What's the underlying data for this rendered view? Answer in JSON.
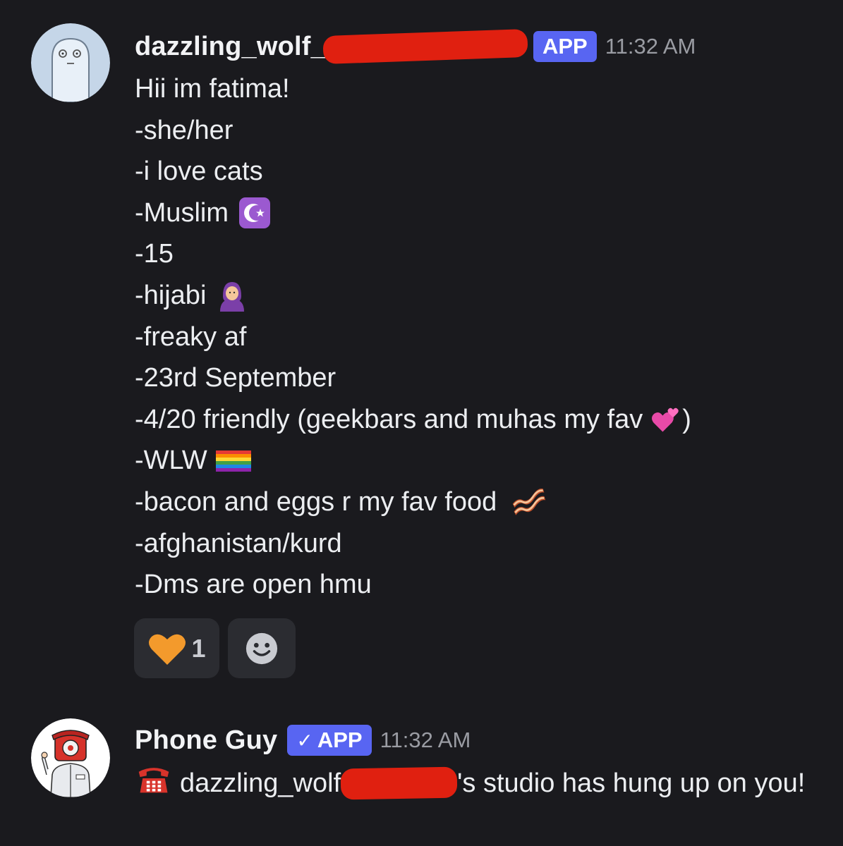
{
  "messages": [
    {
      "username": "dazzling_wolf_",
      "badge": "APP",
      "timestamp": "11:32 AM",
      "lines": [
        "Hii im fatima!",
        "-she/her",
        "-i love cats",
        "-Muslim",
        "-15",
        "-hijabi",
        "-freaky af",
        "-23rd September",
        "-4/20 friendly (geekbars and muhas my fav",
        "-WLW",
        "-bacon and eggs r my fav food",
        "-afghanistan/kurd",
        "-Dms are open hmu"
      ],
      "line_emoji_icons": {
        "3": "star-and-crescent-icon",
        "5": "person-with-headscarf-icon",
        "8": "two-hearts-icon",
        "9": "rainbow-flag-icon",
        "10": "bacon-icon"
      },
      "line8_suffix": ")",
      "reactions": [
        {
          "icon": "orange-heart-icon",
          "count": "1"
        },
        {
          "icon": "add-reaction-smiley-icon"
        }
      ]
    },
    {
      "username": "Phone Guy",
      "badge": "APP",
      "badge_verified": true,
      "timestamp": "11:32 AM",
      "content_icon": "telephone-icon",
      "content_part1": "dazzling_wolf",
      "content_part2": "'s studio has hung up on you!"
    }
  ],
  "colors": {
    "background": "#1a1a1e",
    "app_badge": "#5865f2",
    "redaction": "#e02010",
    "timestamp": "#9a9ca3"
  }
}
